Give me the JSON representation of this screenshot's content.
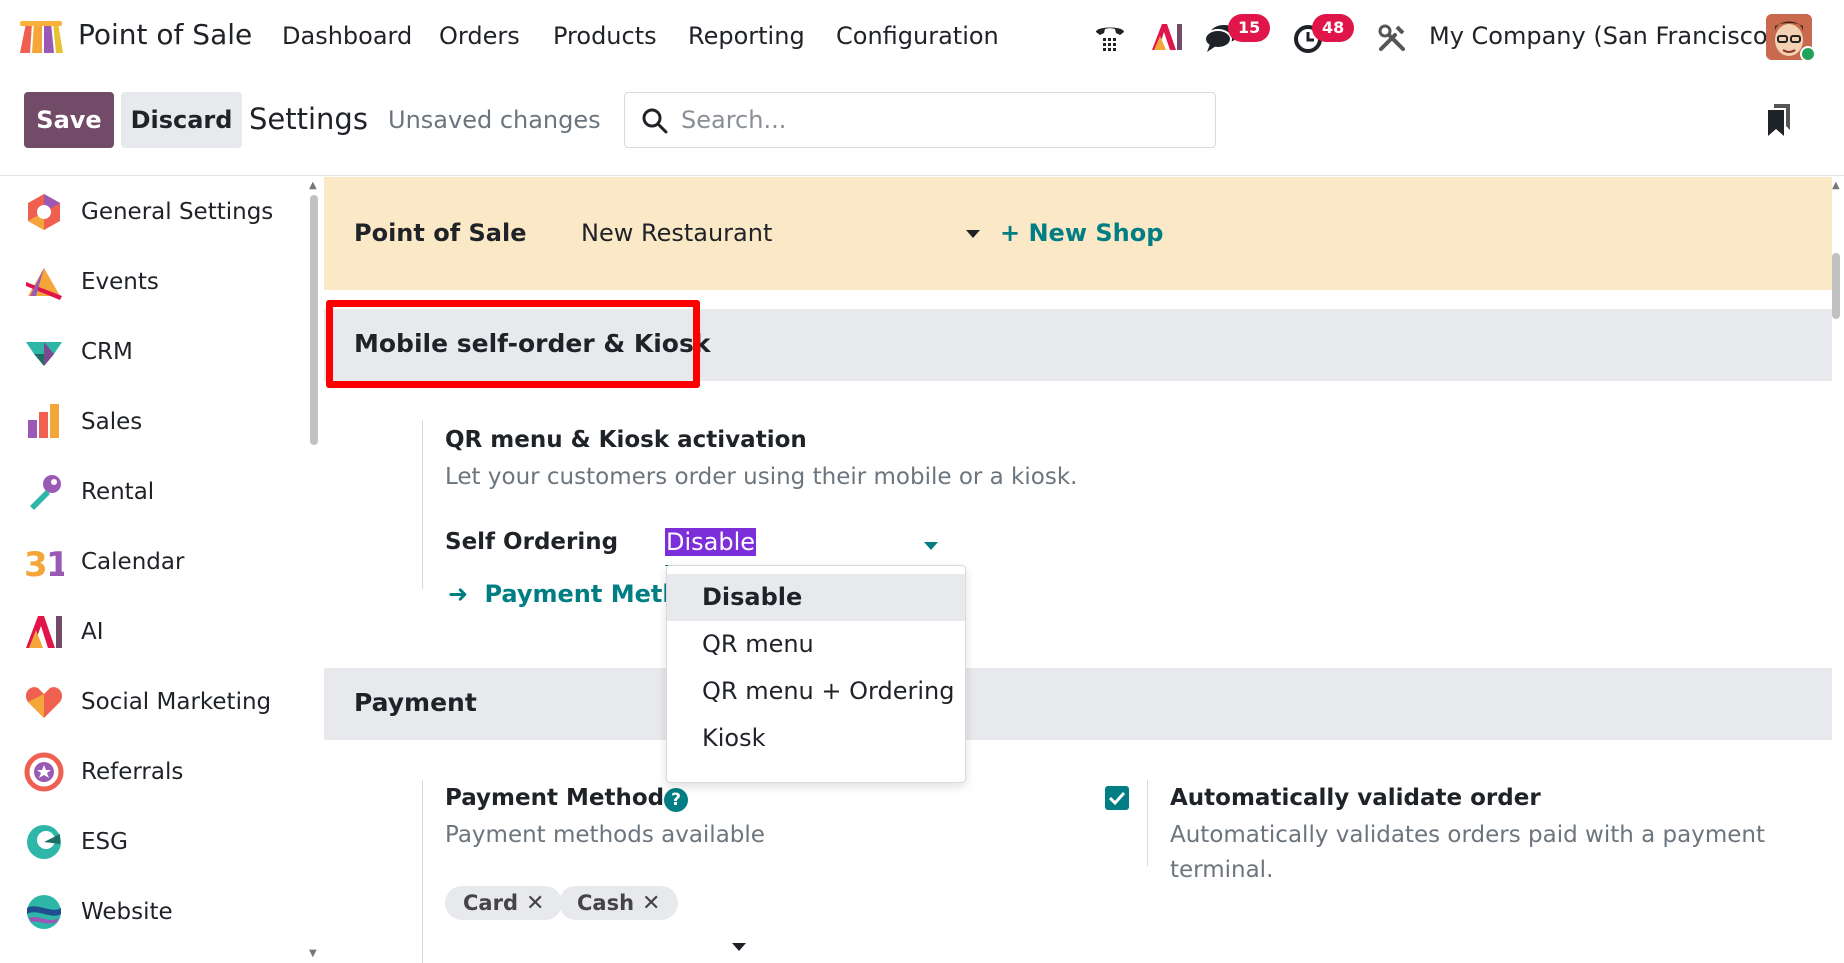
{
  "navbar": {
    "app_name": "Point of Sale",
    "menu": [
      "Dashboard",
      "Orders",
      "Products",
      "Reporting",
      "Configuration"
    ],
    "messages_count": "15",
    "activities_count": "48",
    "company": "My Company (San Francisco)"
  },
  "control": {
    "save_label": "Save",
    "discard_label": "Discard",
    "title": "Settings",
    "status": "Unsaved changes",
    "search_placeholder": "Search..."
  },
  "sidebar": {
    "items": [
      {
        "label": "General Settings",
        "icon": "general-settings-icon"
      },
      {
        "label": "Events",
        "icon": "events-icon"
      },
      {
        "label": "CRM",
        "icon": "crm-icon"
      },
      {
        "label": "Sales",
        "icon": "sales-icon"
      },
      {
        "label": "Rental",
        "icon": "rental-icon"
      },
      {
        "label": "Calendar",
        "icon": "calendar-icon"
      },
      {
        "label": "AI",
        "icon": "ai-icon"
      },
      {
        "label": "Social Marketing",
        "icon": "social-marketing-icon"
      },
      {
        "label": "Referrals",
        "icon": "referrals-icon"
      },
      {
        "label": "ESG",
        "icon": "esg-icon"
      },
      {
        "label": "Website",
        "icon": "website-icon"
      }
    ]
  },
  "pos_banner": {
    "label": "Point of Sale",
    "shop": "New Restaurant",
    "new_shop": "+ New Shop"
  },
  "self_order_section": {
    "title": "Mobile self-order & Kiosk",
    "setting_title": "QR menu & Kiosk activation",
    "setting_desc": "Let your customers order using their mobile or a kiosk.",
    "field_label": "Self Ordering",
    "field_value": "Disable",
    "link": "Payment Metho",
    "options": [
      "Disable",
      "QR menu",
      "QR menu + Ordering",
      "Kiosk"
    ]
  },
  "payment_section": {
    "title": "Payment",
    "methods_title": "Payment Methods",
    "methods_desc": "Payment methods available",
    "tags": [
      "Card",
      "Cash"
    ],
    "auto_validate_title": "Automatically validate order",
    "auto_validate_desc": "Automatically validates orders paid with a payment terminal.",
    "auto_validate_checked": true
  },
  "colors": {
    "primary": "#714b67",
    "accent": "#017e84",
    "banner": "#fbe8c7",
    "badge": "#e0154a",
    "highlight": "#ff0000"
  }
}
